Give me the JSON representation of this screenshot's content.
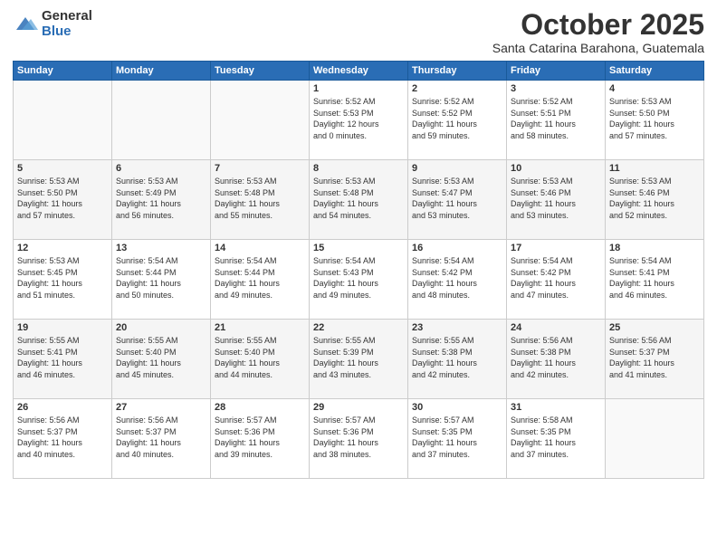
{
  "logo": {
    "general": "General",
    "blue": "Blue"
  },
  "title": "October 2025",
  "subtitle": "Santa Catarina Barahona, Guatemala",
  "weekdays": [
    "Sunday",
    "Monday",
    "Tuesday",
    "Wednesday",
    "Thursday",
    "Friday",
    "Saturday"
  ],
  "weeks": [
    [
      {
        "day": "",
        "info": ""
      },
      {
        "day": "",
        "info": ""
      },
      {
        "day": "",
        "info": ""
      },
      {
        "day": "1",
        "info": "Sunrise: 5:52 AM\nSunset: 5:53 PM\nDaylight: 12 hours\nand 0 minutes."
      },
      {
        "day": "2",
        "info": "Sunrise: 5:52 AM\nSunset: 5:52 PM\nDaylight: 11 hours\nand 59 minutes."
      },
      {
        "day": "3",
        "info": "Sunrise: 5:52 AM\nSunset: 5:51 PM\nDaylight: 11 hours\nand 58 minutes."
      },
      {
        "day": "4",
        "info": "Sunrise: 5:53 AM\nSunset: 5:50 PM\nDaylight: 11 hours\nand 57 minutes."
      }
    ],
    [
      {
        "day": "5",
        "info": "Sunrise: 5:53 AM\nSunset: 5:50 PM\nDaylight: 11 hours\nand 57 minutes."
      },
      {
        "day": "6",
        "info": "Sunrise: 5:53 AM\nSunset: 5:49 PM\nDaylight: 11 hours\nand 56 minutes."
      },
      {
        "day": "7",
        "info": "Sunrise: 5:53 AM\nSunset: 5:48 PM\nDaylight: 11 hours\nand 55 minutes."
      },
      {
        "day": "8",
        "info": "Sunrise: 5:53 AM\nSunset: 5:48 PM\nDaylight: 11 hours\nand 54 minutes."
      },
      {
        "day": "9",
        "info": "Sunrise: 5:53 AM\nSunset: 5:47 PM\nDaylight: 11 hours\nand 53 minutes."
      },
      {
        "day": "10",
        "info": "Sunrise: 5:53 AM\nSunset: 5:46 PM\nDaylight: 11 hours\nand 53 minutes."
      },
      {
        "day": "11",
        "info": "Sunrise: 5:53 AM\nSunset: 5:46 PM\nDaylight: 11 hours\nand 52 minutes."
      }
    ],
    [
      {
        "day": "12",
        "info": "Sunrise: 5:53 AM\nSunset: 5:45 PM\nDaylight: 11 hours\nand 51 minutes."
      },
      {
        "day": "13",
        "info": "Sunrise: 5:54 AM\nSunset: 5:44 PM\nDaylight: 11 hours\nand 50 minutes."
      },
      {
        "day": "14",
        "info": "Sunrise: 5:54 AM\nSunset: 5:44 PM\nDaylight: 11 hours\nand 49 minutes."
      },
      {
        "day": "15",
        "info": "Sunrise: 5:54 AM\nSunset: 5:43 PM\nDaylight: 11 hours\nand 49 minutes."
      },
      {
        "day": "16",
        "info": "Sunrise: 5:54 AM\nSunset: 5:42 PM\nDaylight: 11 hours\nand 48 minutes."
      },
      {
        "day": "17",
        "info": "Sunrise: 5:54 AM\nSunset: 5:42 PM\nDaylight: 11 hours\nand 47 minutes."
      },
      {
        "day": "18",
        "info": "Sunrise: 5:54 AM\nSunset: 5:41 PM\nDaylight: 11 hours\nand 46 minutes."
      }
    ],
    [
      {
        "day": "19",
        "info": "Sunrise: 5:55 AM\nSunset: 5:41 PM\nDaylight: 11 hours\nand 46 minutes."
      },
      {
        "day": "20",
        "info": "Sunrise: 5:55 AM\nSunset: 5:40 PM\nDaylight: 11 hours\nand 45 minutes."
      },
      {
        "day": "21",
        "info": "Sunrise: 5:55 AM\nSunset: 5:40 PM\nDaylight: 11 hours\nand 44 minutes."
      },
      {
        "day": "22",
        "info": "Sunrise: 5:55 AM\nSunset: 5:39 PM\nDaylight: 11 hours\nand 43 minutes."
      },
      {
        "day": "23",
        "info": "Sunrise: 5:55 AM\nSunset: 5:38 PM\nDaylight: 11 hours\nand 42 minutes."
      },
      {
        "day": "24",
        "info": "Sunrise: 5:56 AM\nSunset: 5:38 PM\nDaylight: 11 hours\nand 42 minutes."
      },
      {
        "day": "25",
        "info": "Sunrise: 5:56 AM\nSunset: 5:37 PM\nDaylight: 11 hours\nand 41 minutes."
      }
    ],
    [
      {
        "day": "26",
        "info": "Sunrise: 5:56 AM\nSunset: 5:37 PM\nDaylight: 11 hours\nand 40 minutes."
      },
      {
        "day": "27",
        "info": "Sunrise: 5:56 AM\nSunset: 5:37 PM\nDaylight: 11 hours\nand 40 minutes."
      },
      {
        "day": "28",
        "info": "Sunrise: 5:57 AM\nSunset: 5:36 PM\nDaylight: 11 hours\nand 39 minutes."
      },
      {
        "day": "29",
        "info": "Sunrise: 5:57 AM\nSunset: 5:36 PM\nDaylight: 11 hours\nand 38 minutes."
      },
      {
        "day": "30",
        "info": "Sunrise: 5:57 AM\nSunset: 5:35 PM\nDaylight: 11 hours\nand 37 minutes."
      },
      {
        "day": "31",
        "info": "Sunrise: 5:58 AM\nSunset: 5:35 PM\nDaylight: 11 hours\nand 37 minutes."
      },
      {
        "day": "",
        "info": ""
      }
    ]
  ]
}
